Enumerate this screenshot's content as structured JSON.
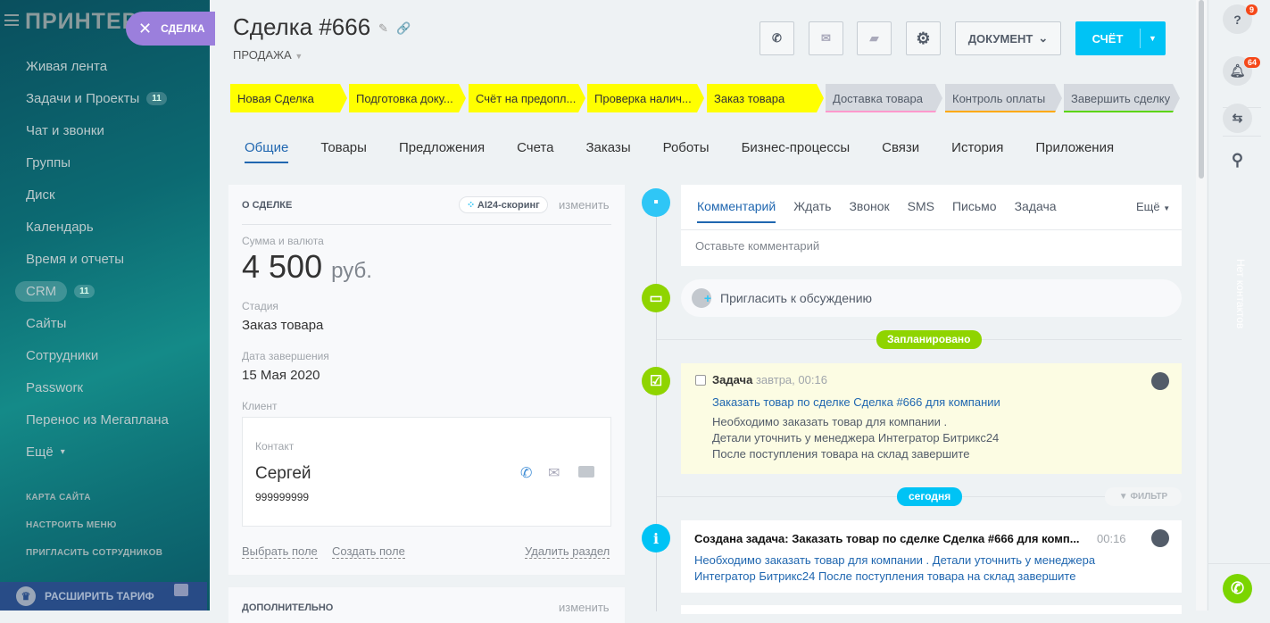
{
  "sidebar": {
    "logo": "ПРИНТЕРЫ",
    "deal_pill": "СДЕЛКА",
    "items": [
      {
        "label": "Живая лента"
      },
      {
        "label": "Задачи и Проекты",
        "count": "11"
      },
      {
        "label": "Чат и звонки"
      },
      {
        "label": "Группы"
      },
      {
        "label": "Диск"
      },
      {
        "label": "Календарь"
      },
      {
        "label": "Время и отчеты"
      },
      {
        "label": "CRM",
        "count": "11"
      },
      {
        "label": "Сайты"
      },
      {
        "label": "Сотрудники"
      },
      {
        "label": "Passworк"
      },
      {
        "label": "Перенос из Мегаплана"
      },
      {
        "label": "Ещё"
      }
    ],
    "links": [
      "КАРТА САЙТА",
      "НАСТРОИТЬ МЕНЮ",
      "ПРИГЛАСИТЬ СОТРУДНИКОВ"
    ],
    "tariff": "РАСШИРИТЬ ТАРИФ"
  },
  "header": {
    "title": "Сделка #666",
    "category": "ПРОДАЖА",
    "document": "ДОКУМЕНТ",
    "bill": "СЧЁТ"
  },
  "stages": [
    {
      "label": "Новая Сделка",
      "done": true
    },
    {
      "label": "Подготовка доку...",
      "done": true
    },
    {
      "label": "Счёт на предопл...",
      "done": true
    },
    {
      "label": "Проверка налич...",
      "done": true
    },
    {
      "label": "Заказ товара",
      "done": true
    },
    {
      "label": "Доставка товара",
      "done": false,
      "color": "#ff99cc"
    },
    {
      "label": "Контроль оплаты",
      "done": false,
      "color": "#ffa900"
    },
    {
      "label": "Завершить сделку",
      "done": false,
      "color": "#5bd503"
    }
  ],
  "tabs": [
    "Общие",
    "Товары",
    "Предложения",
    "Счета",
    "Заказы",
    "Роботы",
    "Бизнес-процессы",
    "Связи",
    "История",
    "Приложения"
  ],
  "about": {
    "heading": "О СДЕЛКЕ",
    "scoring": "AI24-скоринг",
    "edit": "изменить",
    "amount_label": "Сумма и валюта",
    "amount": "4 500",
    "currency": "руб.",
    "stage_label": "Стадия",
    "stage": "Заказ товара",
    "date_label": "Дата завершения",
    "date": "15 Мая 2020",
    "client_label": "Клиент",
    "contact_label": "Контакт",
    "contact_name": "Сергей",
    "contact_phone": "999999999",
    "select_field": "Выбрать поле",
    "create_field": "Создать поле",
    "delete_section": "Удалить раздел"
  },
  "extra": {
    "heading": "ДОПОЛНИТЕЛЬНО",
    "edit": "изменить"
  },
  "composer": {
    "tabs": [
      "Комментарий",
      "Ждать",
      "Звонок",
      "SMS",
      "Письмо",
      "Задача"
    ],
    "more": "Ещё",
    "placeholder": "Оставьте комментарий"
  },
  "invite": "Пригласить к обсуждению",
  "planned_label": "Запланировано",
  "task": {
    "title": "Задача",
    "time": "завтра, 00:16",
    "link": "Заказать товар по сделке Сделка #666 для компании",
    "lines": [
      "Необходимо заказать товар для компании .",
      "Детали уточнить у менеджера Интегратор Битрикс24",
      "После поступления товара на склад завершите"
    ]
  },
  "today_label": "сегодня",
  "filter": "ФИЛЬТР",
  "created": {
    "title": "Создана задача: Заказать товар по сделке Сделка #666 для комп...",
    "time": "00:16",
    "text1": "Необходимо заказать товар для компании . Детали уточнить у менеджера",
    "text2": "Интегратор Битрикс24 После поступления товара на склад завершите"
  },
  "right_panel": {
    "help_badge": "9",
    "notif_badge": "64",
    "no_contacts": "Нет контактов"
  }
}
